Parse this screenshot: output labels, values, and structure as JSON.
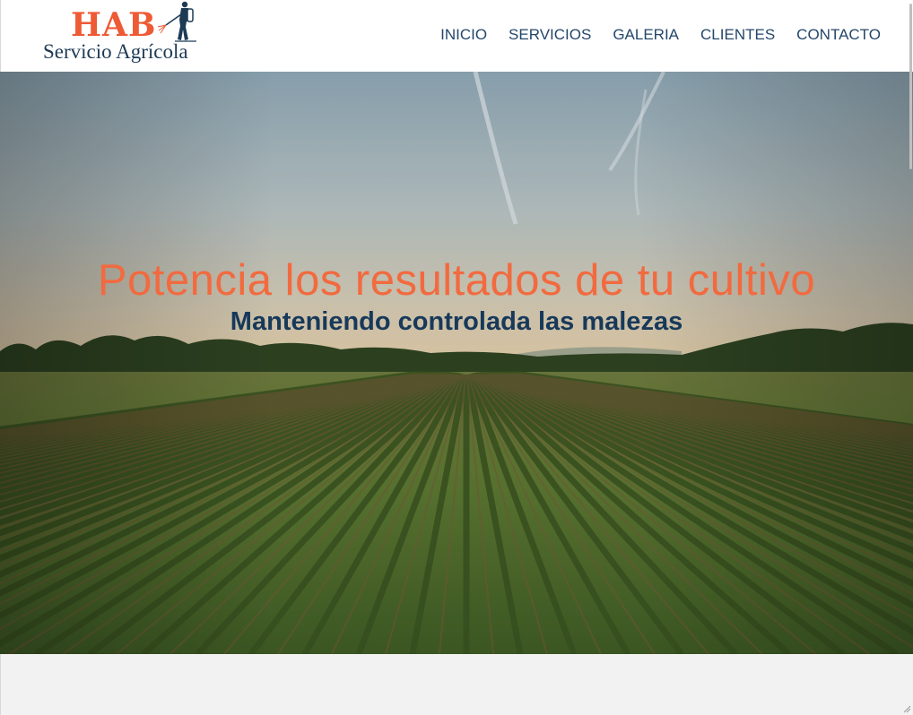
{
  "brand": {
    "name": "HAB",
    "tagline": "Servicio Agrícola",
    "logo_icon": "sprayer-worker-icon",
    "primary_color": "#ee5a34",
    "secondary_color": "#1d3a55"
  },
  "nav": {
    "items": [
      {
        "label": "INICIO"
      },
      {
        "label": "SERVICIOS"
      },
      {
        "label": "GALERIA"
      },
      {
        "label": "CLIENTES"
      },
      {
        "label": "CONTACTO"
      }
    ],
    "color": "#24466a"
  },
  "hero": {
    "title": "Potencia los resultados de tu cultivo",
    "subtitle": "Manteniendo controlada las malezas",
    "title_color": "#f26a3f",
    "subtitle_color": "#17395a",
    "background": "crop-field-photo"
  }
}
